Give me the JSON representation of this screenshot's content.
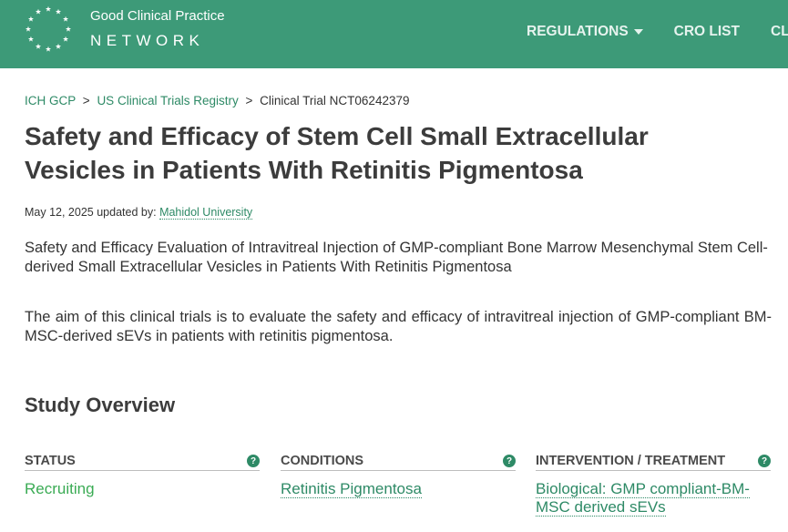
{
  "header": {
    "logo_line1": "Good Clinical Practice",
    "logo_line2": "NETWORK",
    "nav": [
      {
        "label": "REGULATIONS",
        "has_dropdown": true
      },
      {
        "label": "CRO LIST",
        "has_dropdown": false
      },
      {
        "label": "CLIN",
        "has_dropdown": false
      }
    ],
    "bg_color": "#3d9a78"
  },
  "breadcrumb": {
    "items": [
      "ICH GCP",
      "US Clinical Trials Registry"
    ],
    "current": "Clinical Trial NCT06242379",
    "separator": ">"
  },
  "page": {
    "title": "Safety and Efficacy of Stem Cell Small Extracellular Vesicles in Patients With Retinitis Pigmentosa",
    "date": "May 12, 2025",
    "updated_by_label": "updated by:",
    "updated_by": "Mahidol University",
    "subtitle": "Safety and Efficacy Evaluation of Intravitreal Injection of GMP-compliant Bone Marrow Mesenchymal Stem Cell-derived Small Extracellular Vesicles in Patients With Retinitis Pigmentosa",
    "description": "The aim of this clinical trials is to evaluate the safety and efficacy of intravitreal injection of GMP-compliant BM-MSC-derived sEVs in patients with retinitis pigmentosa."
  },
  "overview": {
    "title": "Study Overview",
    "help_glyph": "?",
    "columns": [
      {
        "label": "STATUS",
        "value": "Recruiting"
      },
      {
        "label": "CONDITIONS",
        "value": "Retinitis Pigmentosa"
      },
      {
        "label": "INTERVENTION / TREATMENT",
        "value": "Biological: GMP compliant-BM-MSC derived sEVs"
      }
    ]
  },
  "colors": {
    "accent": "#2e8a66",
    "status": "#3aab54"
  }
}
